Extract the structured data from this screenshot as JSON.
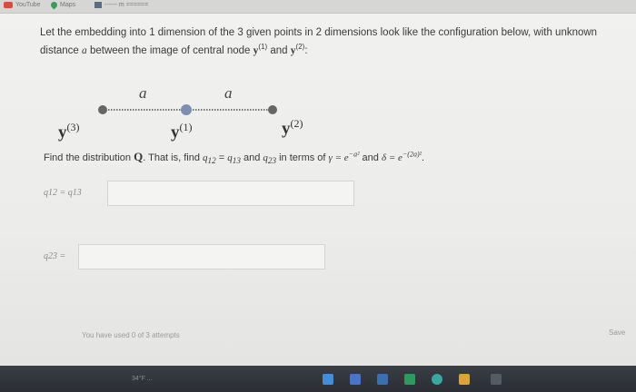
{
  "bookmarks": {
    "youtube": "YouTube",
    "maps": "Maps",
    "extra": "------ m ======"
  },
  "question": {
    "line1": "Let the embedding into 1 dimension of the 3 given points in 2 dimensions look like the configuration below, with unknown",
    "line2_pre": "distance",
    "line2_var": "a",
    "line2_mid": "between the image of central node",
    "y1": "y",
    "y1_sup": "(1)",
    "line2_and": "and",
    "y2": "y",
    "y2_sup": "(2)",
    "line2_end": ":"
  },
  "diagram": {
    "distance_label_left": "a",
    "distance_label_right": "a",
    "node3": {
      "base": "y",
      "sup": "(3)"
    },
    "node1": {
      "base": "y",
      "sup": "(1)"
    },
    "node2": {
      "base": "y",
      "sup": "(2)"
    },
    "colors": {
      "end_nodes": "#666666",
      "center_node": "#7d8fb0",
      "line": "#777777"
    }
  },
  "find": {
    "pre": "Find the distribution",
    "Q": "Q",
    "mid": ". That is, find",
    "q12": "q",
    "q12_sub": "12",
    "eq": "=",
    "q13": "q",
    "q13_sub": "13",
    "and1": "and",
    "q23": "q",
    "q23_sub": "23",
    "interms": "in terms of",
    "gamma_def": "γ = e",
    "gamma_exp": "−a²",
    "and2": "and",
    "delta_def": "δ = e",
    "delta_exp": "−(2a)²",
    "end": "."
  },
  "answers": {
    "row1_label": "q12 = q13",
    "row2_label": "q23 ="
  },
  "footer": {
    "attempts": "You have used 0 of 3 attempts",
    "save": "Save"
  },
  "taskbar": {
    "weather": "34°F ..."
  }
}
